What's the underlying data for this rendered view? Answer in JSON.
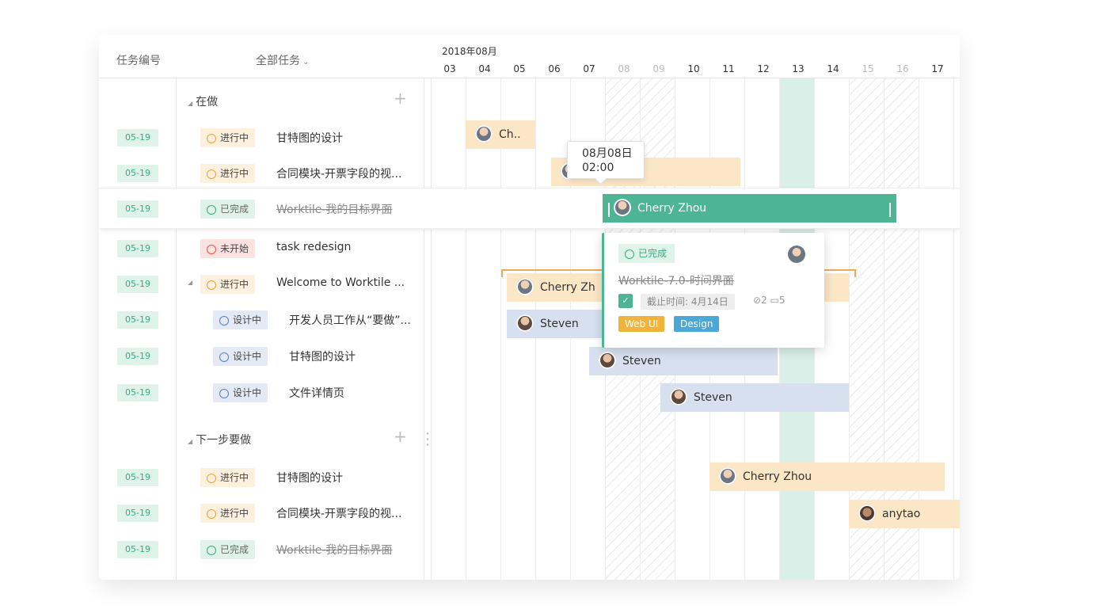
{
  "header": {
    "id_label": "任务编号",
    "filter_label": "全部任务",
    "filter_caret": "⌄",
    "month": "2018年08月",
    "days": [
      "03",
      "04",
      "05",
      "06",
      "07",
      "08",
      "09",
      "10",
      "11",
      "12",
      "13",
      "14",
      "15",
      "16",
      "17"
    ]
  },
  "groups": [
    {
      "label": "在做",
      "tri": "◢",
      "plus": "+"
    },
    {
      "label": "下一步要做",
      "tri": "◢",
      "plus": "+"
    }
  ],
  "rows": [
    {
      "id": "05-19",
      "status": "进行中",
      "name": "甘特图的设计"
    },
    {
      "id": "05-19",
      "status": "进行中",
      "name": "合同模块-开票字段的视..."
    },
    {
      "id": "05-19",
      "status": "已完成",
      "name": "Worktile-我的目标界面"
    },
    {
      "id": "05-19",
      "status": "未开始",
      "name": "task redesign"
    },
    {
      "id": "05-19",
      "status": "进行中",
      "name": "Welcome to Worktile ..."
    },
    {
      "id": "05-19",
      "status": "设计中",
      "name": "开发人员工作从“要做”..."
    },
    {
      "id": "05-19",
      "status": "设计中",
      "name": "甘特图的设计"
    },
    {
      "id": "05-19",
      "status": "设计中",
      "name": "文件详情页"
    },
    {
      "id": "05-19",
      "status": "进行中",
      "name": "甘特图的设计"
    },
    {
      "id": "05-19",
      "status": "进行中",
      "name": "合同模块-开票字段的视..."
    },
    {
      "id": "05-19",
      "status": "已完成",
      "name": "Worktile-我的目标界面"
    }
  ],
  "bars": {
    "b1": "Ch..",
    "b3": "Cherry Zhou",
    "b5": "Cherry Zh",
    "b6": "Steven",
    "b7": "Steven",
    "b8": "Steven",
    "b9": "Cherry Zhou",
    "b10": "anytao"
  },
  "tooltip": {
    "line1": "08月08日",
    "line2": "02:00"
  },
  "popup": {
    "status": "已完成",
    "title": "Worktile-7.0-时间界面",
    "due": "截止时间: 4月14日",
    "attachments": "2",
    "comments": "5",
    "tags": [
      {
        "label": "Web UI",
        "color": "#f0b43c"
      },
      {
        "label": "Design",
        "color": "#4aa8d8"
      }
    ]
  },
  "colors": {
    "accent_green": "#4db594",
    "progress_orange": "#e8a33d",
    "todo_red": "#e5534b",
    "design_blue": "#5a7fb8"
  }
}
